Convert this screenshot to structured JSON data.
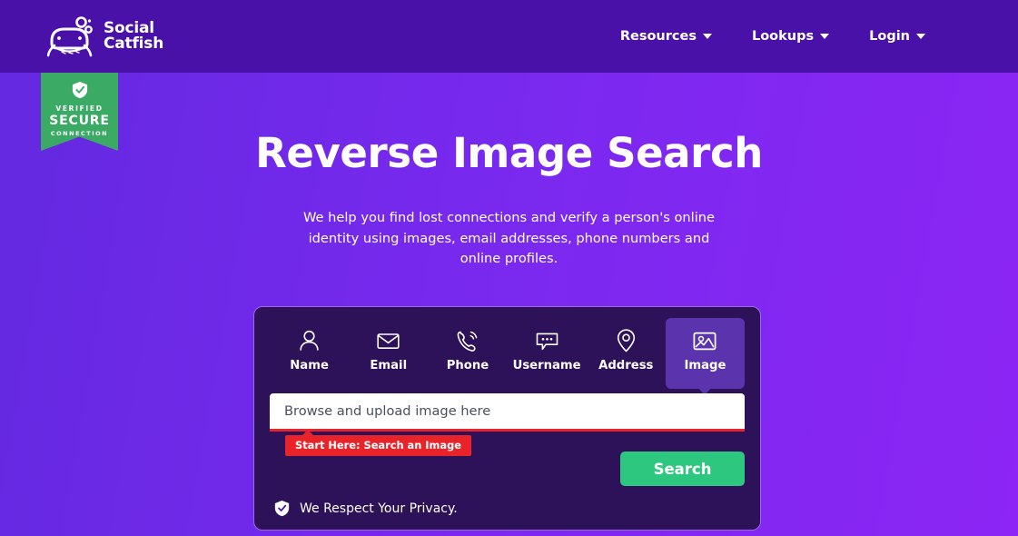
{
  "header": {
    "logo": {
      "line1": "Social",
      "line2": "Catfish",
      "icon": "catfish-logo-icon"
    },
    "nav": [
      {
        "label": "Resources",
        "icon": "chevron-down-icon"
      },
      {
        "label": "Lookups",
        "icon": "chevron-down-icon"
      },
      {
        "label": "Login",
        "icon": "chevron-down-icon"
      }
    ],
    "bg_color": "#4a11a8"
  },
  "badge": {
    "icon": "shield-check-icon",
    "line1": "VERIFIED",
    "line2": "SECURE",
    "line3": "CONNECTION",
    "color": "#3aaa64"
  },
  "hero": {
    "title": "Reverse Image Search",
    "subtitle": "We help you find lost connections and verify a person's online identity using images, email addresses, phone numbers and online profiles."
  },
  "search_card": {
    "tabs": [
      {
        "label": "Name",
        "icon": "person-icon",
        "active": false
      },
      {
        "label": "Email",
        "icon": "envelope-icon",
        "active": false
      },
      {
        "label": "Phone",
        "icon": "phone-icon",
        "active": false
      },
      {
        "label": "Username",
        "icon": "speech-bubble-icon",
        "active": false
      },
      {
        "label": "Address",
        "icon": "map-pin-icon",
        "active": false
      },
      {
        "label": "Image",
        "icon": "image-icon",
        "active": true
      }
    ],
    "input": {
      "value": "",
      "placeholder": "Browse and upload image here"
    },
    "tooltip": {
      "text": "Start Here: Search an Image",
      "color": "#e8242a"
    },
    "search_button": {
      "label": "Search",
      "color": "#2ec77f"
    },
    "privacy": {
      "icon": "shield-check-icon",
      "text": "We Respect Your Privacy."
    }
  }
}
